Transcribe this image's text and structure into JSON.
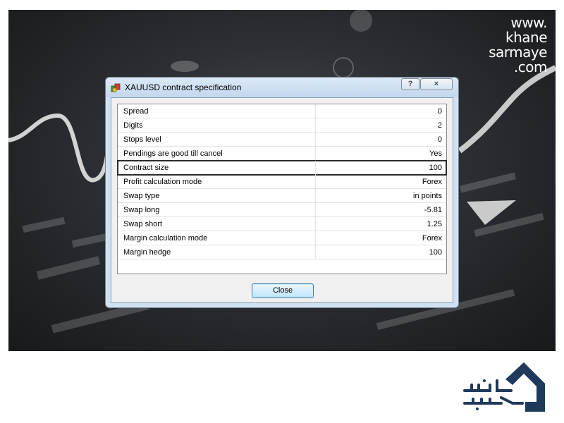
{
  "watermark": {
    "line1": "www.",
    "line2": "khane",
    "line3": "sarmaye",
    "line4": ".com"
  },
  "dialog": {
    "title": "XAUUSD contract specification",
    "help_label": "?",
    "close_x_label": "×",
    "close_button_label": "Close",
    "rows": [
      {
        "name": "Spread",
        "value": "0"
      },
      {
        "name": "Digits",
        "value": "2"
      },
      {
        "name": "Stops level",
        "value": "0"
      },
      {
        "name": "Pendings are good till cancel",
        "value": "Yes"
      },
      {
        "name": "Contract size",
        "value": "100"
      },
      {
        "name": "Profit calculation mode",
        "value": "Forex"
      },
      {
        "name": "Swap type",
        "value": "in points"
      },
      {
        "name": "Swap long",
        "value": "-5.81"
      },
      {
        "name": "Swap short",
        "value": "1.25"
      },
      {
        "name": "Margin calculation mode",
        "value": "Forex"
      },
      {
        "name": "Margin hedge",
        "value": "100"
      }
    ],
    "selected_row": "Contract size"
  },
  "icons": {
    "app": "terminal-app-icon",
    "logo": "khane-sarmaye-logo"
  },
  "colors": {
    "backdrop": "#2c2f33",
    "dialog_frame": "#cfe0f2",
    "button_accent": "#3c7fb1",
    "logo": "#1f3a5a"
  }
}
